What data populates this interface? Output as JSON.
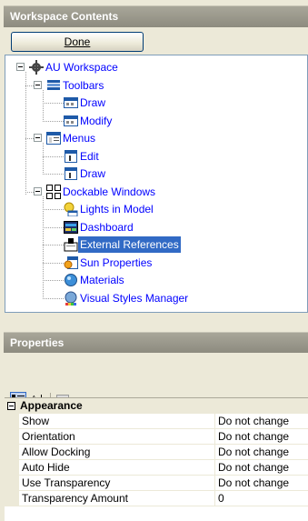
{
  "workspace": {
    "title": "Workspace Contents",
    "done_label": "Done",
    "tree": [
      {
        "label": "AU Workspace",
        "icon": "gear-icon",
        "level": 0,
        "expander": true
      },
      {
        "label": "Toolbars",
        "icon": "toolbar-icon",
        "level": 1,
        "expander": true
      },
      {
        "label": "Draw",
        "icon": "toolbar-item-icon",
        "level": 2
      },
      {
        "label": "Modify",
        "icon": "toolbar-item-icon",
        "level": 2
      },
      {
        "label": "Menus",
        "icon": "menus-icon",
        "level": 1,
        "expander": true
      },
      {
        "label": "Edit",
        "icon": "menu-item-icon",
        "level": 2
      },
      {
        "label": "Draw",
        "icon": "menu-item-icon",
        "level": 2
      },
      {
        "label": "Dockable Windows",
        "icon": "dockable-windows-icon",
        "level": 1,
        "expander": true
      },
      {
        "label": "Lights in Model",
        "icon": "lights-icon",
        "level": 2
      },
      {
        "label": "Dashboard",
        "icon": "dashboard-icon",
        "level": 2
      },
      {
        "label": "External References",
        "icon": "xref-icon",
        "level": 2,
        "selected": true
      },
      {
        "label": "Sun Properties",
        "icon": "sun-icon",
        "level": 2
      },
      {
        "label": "Materials",
        "icon": "materials-icon",
        "level": 2
      },
      {
        "label": "Visual Styles Manager",
        "icon": "visual-styles-icon",
        "level": 2
      }
    ]
  },
  "properties": {
    "title": "Properties",
    "category": "Appearance",
    "rows": [
      {
        "name": "Show",
        "value": "Do not change"
      },
      {
        "name": "Orientation",
        "value": "Do not change"
      },
      {
        "name": "Allow Docking",
        "value": "Do not change"
      },
      {
        "name": "Auto Hide",
        "value": "Do not change"
      },
      {
        "name": "Use Transparency",
        "value": "Do not change"
      },
      {
        "name": "Transparency Amount",
        "value": "0"
      }
    ]
  }
}
